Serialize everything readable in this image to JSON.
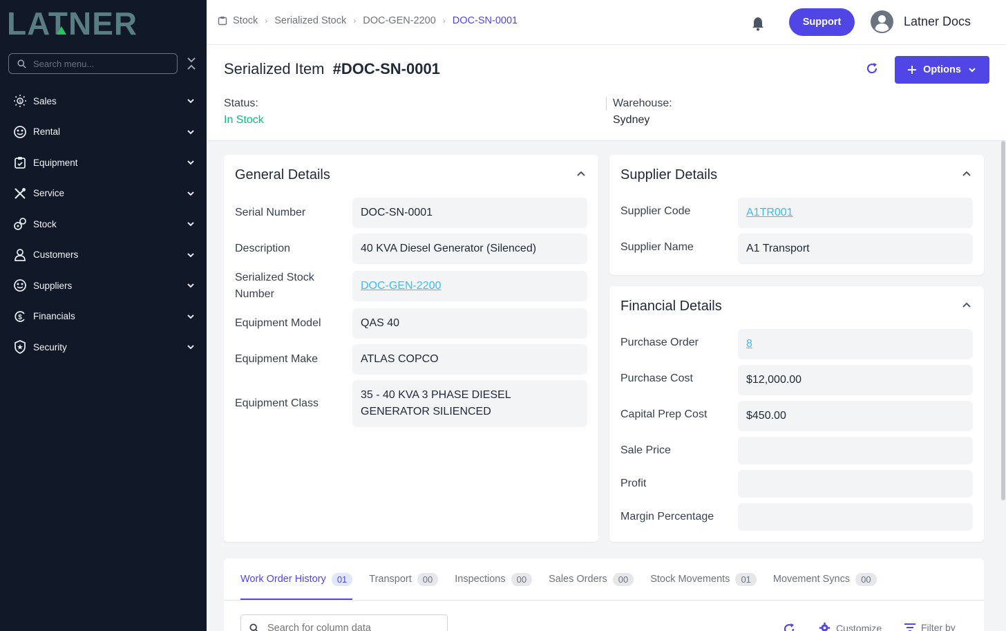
{
  "brand": {
    "logo_text": "LATNER"
  },
  "sidebar": {
    "search_placeholder": "Search menu...",
    "items": [
      {
        "label": "Sales",
        "icon": "sales-icon"
      },
      {
        "label": "Rental",
        "icon": "rental-icon"
      },
      {
        "label": "Equipment",
        "icon": "equipment-icon"
      },
      {
        "label": "Service",
        "icon": "service-icon"
      },
      {
        "label": "Stock",
        "icon": "stock-icon"
      },
      {
        "label": "Customers",
        "icon": "customers-icon"
      },
      {
        "label": "Suppliers",
        "icon": "suppliers-icon"
      },
      {
        "label": "Financials",
        "icon": "financials-icon"
      },
      {
        "label": "Security",
        "icon": "security-icon"
      }
    ]
  },
  "topbar": {
    "breadcrumbs": [
      "Stock",
      "Serialized Stock",
      "DOC-GEN-2200",
      "DOC-SN-0001"
    ],
    "support_label": "Support",
    "user_name": "Latner Docs"
  },
  "header": {
    "title": "Serialized Item",
    "item_id": "#DOC-SN-0001",
    "options_label": "Options",
    "status_label": "Status:",
    "status_value": "In Stock",
    "warehouse_label": "Warehouse:",
    "warehouse_value": "Sydney"
  },
  "general": {
    "title": "General Details",
    "fields": [
      {
        "label": "Serial Number",
        "value": "DOC-SN-0001"
      },
      {
        "label": "Description",
        "value": "40 KVA Diesel Generator (Silenced)"
      },
      {
        "label": "Serialized Stock Number",
        "value": "DOC-GEN-2200"
      },
      {
        "label": "Equipment Model",
        "value": "QAS 40"
      },
      {
        "label": "Equipment Make",
        "value": "ATLAS COPCO"
      },
      {
        "label": "Equipment Class",
        "value": "35 - 40 KVA 3 PHASE DIESEL GENERATOR SILIENCED"
      }
    ]
  },
  "supplier": {
    "title": "Supplier Details",
    "fields": [
      {
        "label": "Supplier Code",
        "value": "A1TR001"
      },
      {
        "label": "Supplier Name",
        "value": "A1 Transport"
      }
    ]
  },
  "financial": {
    "title": "Financial Details",
    "fields": [
      {
        "label": "Purchase Order",
        "value": "8"
      },
      {
        "label": "Purchase Cost",
        "value": "$12,000.00"
      },
      {
        "label": "Capital Prep Cost",
        "value": "$450.00"
      },
      {
        "label": "Sale Price",
        "value": ""
      },
      {
        "label": "Profit",
        "value": ""
      },
      {
        "label": "Margin Percentage",
        "value": ""
      }
    ]
  },
  "tabs": [
    {
      "label": "Work Order History",
      "count": "01",
      "active": true
    },
    {
      "label": "Transport",
      "count": "00"
    },
    {
      "label": "Inspections",
      "count": "00"
    },
    {
      "label": "Sales Orders",
      "count": "00"
    },
    {
      "label": "Stock Movements",
      "count": "01"
    },
    {
      "label": "Movement Syncs",
      "count": "00"
    }
  ],
  "table_tools": {
    "search_placeholder": "Search for column data",
    "customize_label": "Customize",
    "filter_label": "Filter by"
  },
  "colors": {
    "accent": "#4f46e5",
    "sidebar_bg": "#111827",
    "status_green": "#10b981",
    "logo": "#6b8a8e"
  }
}
